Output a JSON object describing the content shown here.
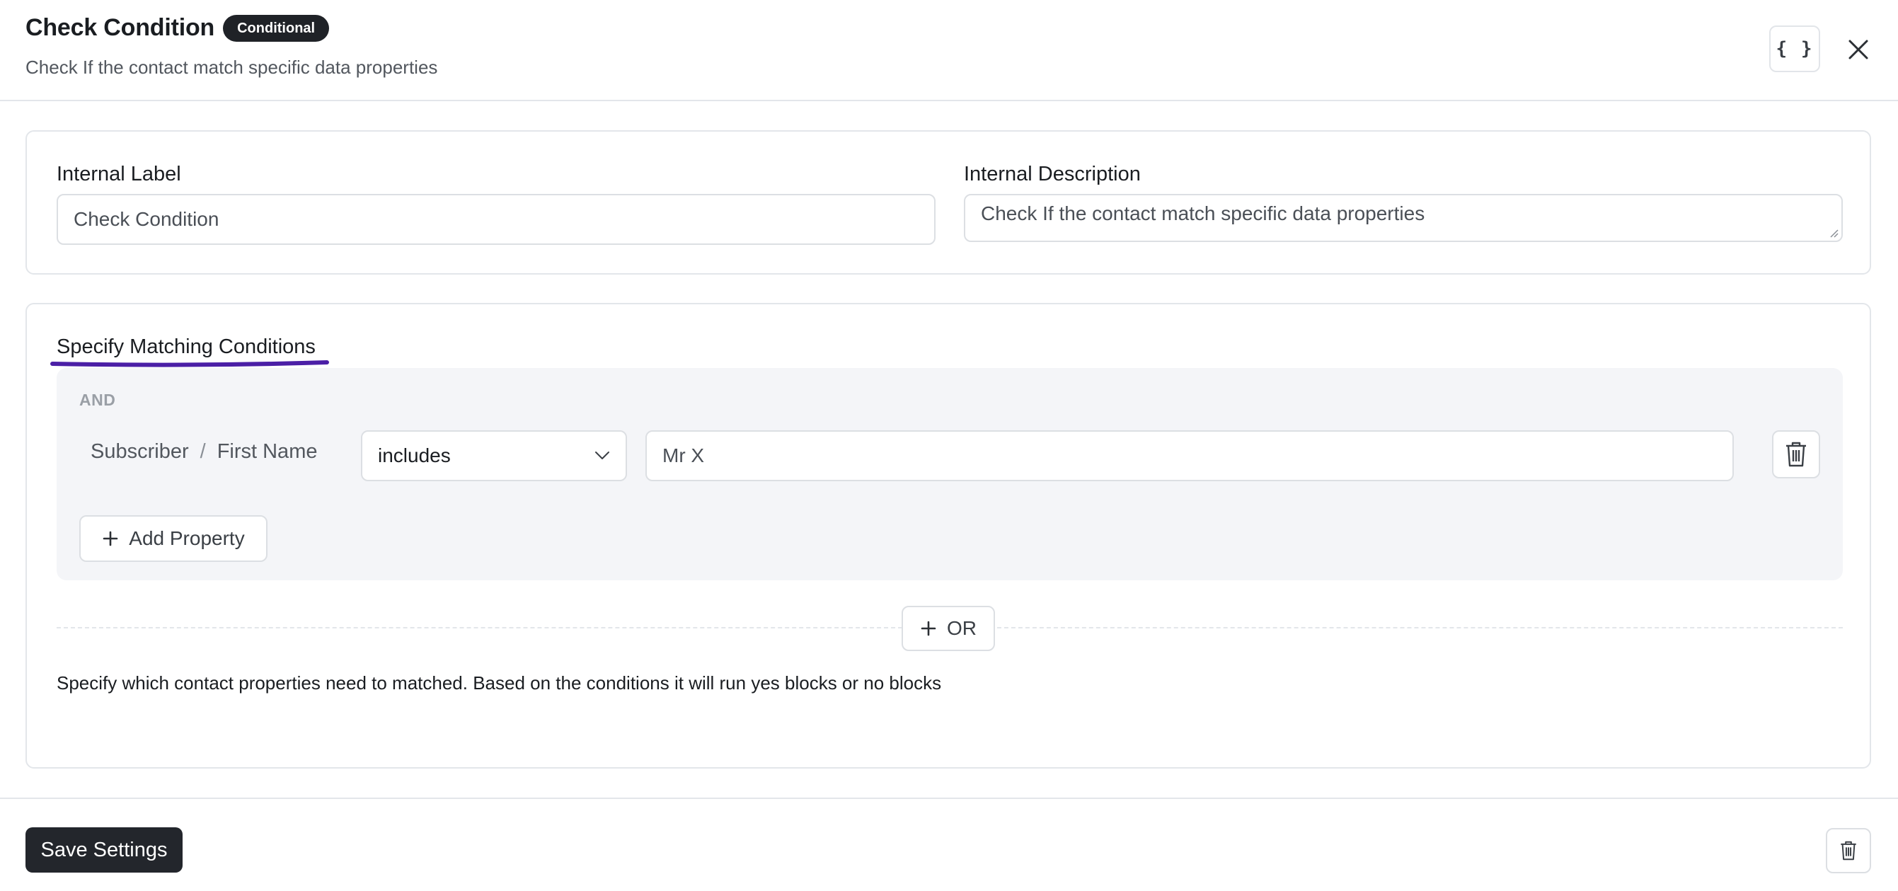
{
  "header": {
    "title": "Check Condition",
    "badge": "Conditional",
    "subtitle": "Check If the contact match specific data properties",
    "code_button_label": "{ }"
  },
  "settings": {
    "internal_label": {
      "label": "Internal Label",
      "value": "Check Condition"
    },
    "internal_description": {
      "label": "Internal Description",
      "value": "Check If the contact match specific data properties"
    }
  },
  "conditions": {
    "title": "Specify Matching Conditions",
    "group_operator": "AND",
    "rules": [
      {
        "property_group": "Subscriber",
        "separator": "/",
        "property": "First Name",
        "operator": "includes",
        "value": "Mr X"
      }
    ],
    "add_property_label": "Add Property",
    "or_label": "OR",
    "helper_text": "Specify which contact properties need to matched. Based on the conditions it will run yes blocks or no blocks"
  },
  "footer": {
    "save_label": "Save Settings"
  },
  "colors": {
    "accent_underline": "#4b1fa6",
    "primary_button": "#23262c",
    "group_background": "#f4f5f8"
  },
  "icons": [
    "code-braces-icon",
    "close-icon",
    "chevron-down-icon",
    "trash-icon",
    "plus-icon"
  ]
}
